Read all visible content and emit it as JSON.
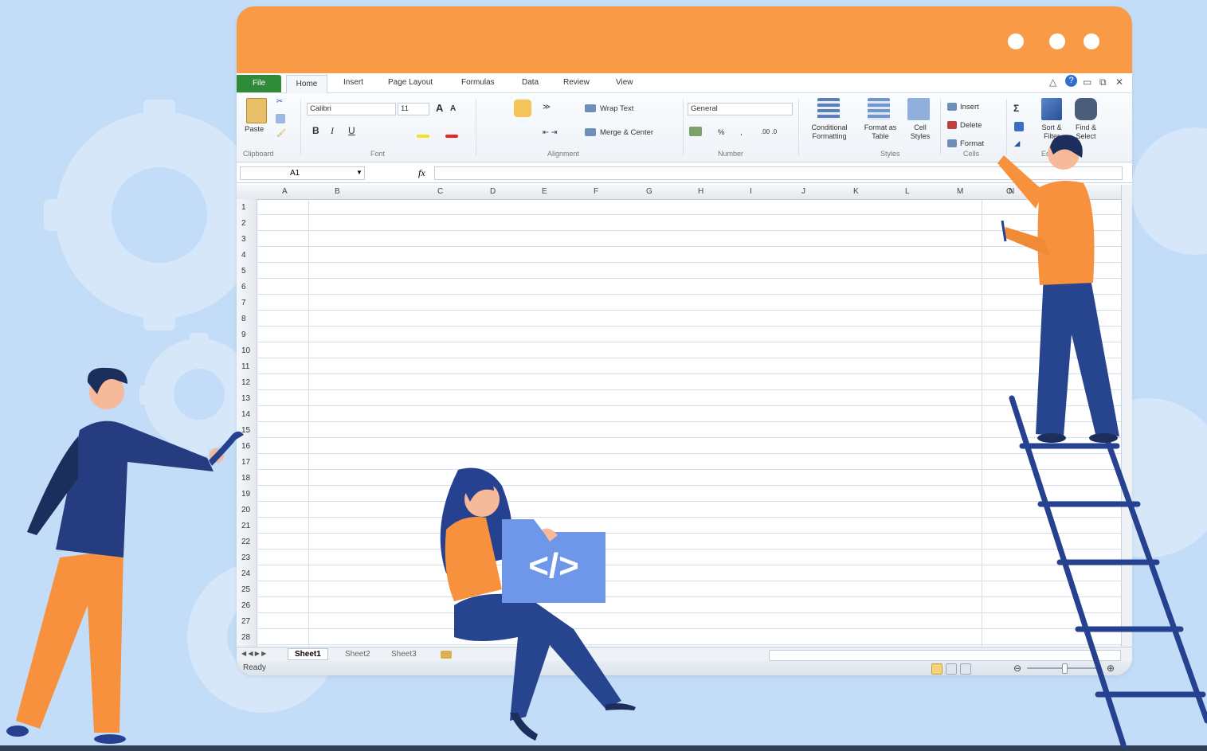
{
  "colors": {
    "background": "#c3ddf8",
    "titlebar": "#f99a47",
    "file_tab": "#2f8a3a",
    "code_card": "#6e97e9",
    "figure_orange": "#f7913d",
    "figure_navy": "#253d80"
  },
  "menu": {
    "file": "File",
    "tabs": [
      "Home",
      "Insert",
      "Page Layout",
      "Formulas",
      "Data",
      "Review",
      "View"
    ]
  },
  "ribbon": {
    "clipboard": {
      "paste": "Paste",
      "group": "Clipboard"
    },
    "font": {
      "name": "Calibri",
      "size": "11",
      "bold": "B",
      "italic": "I",
      "underline": "U",
      "grow": "A",
      "shrink": "A",
      "group": "Font"
    },
    "alignment": {
      "wrap_text": "Wrap Text",
      "merge_center": "Merge & Center",
      "group": "Alignment"
    },
    "number": {
      "format": "General",
      "percent": "%",
      "comma": ",",
      "group": "Number"
    },
    "styles": {
      "conditional": "Conditional Formatting",
      "format_table": "Format as Table",
      "cell_styles": "Cell Styles",
      "group": "Styles"
    },
    "cells": {
      "insert": "Insert",
      "delete": "Delete",
      "format": "Format",
      "group": "Cells"
    },
    "editing": {
      "sum": "Σ",
      "sort_filter": "Sort & Filter",
      "find_select": "Find & Select",
      "group": "Editing"
    }
  },
  "formula_bar": {
    "name_box": "A1",
    "fx": "fx"
  },
  "columns": [
    "A",
    "B",
    "C",
    "D",
    "E",
    "F",
    "G",
    "H",
    "I",
    "J",
    "K",
    "L",
    "M",
    "N",
    "O"
  ],
  "rows": [
    "1",
    "2",
    "3",
    "4",
    "5",
    "6",
    "7",
    "8",
    "9",
    "10",
    "11",
    "12",
    "13",
    "14",
    "15",
    "16",
    "17",
    "18",
    "19",
    "20",
    "21",
    "22",
    "23",
    "24",
    "25",
    "26",
    "27",
    "28"
  ],
  "sheets": [
    "Sheet1",
    "Sheet2",
    "Sheet3"
  ],
  "status": {
    "ready": "Ready"
  },
  "code_symbol": "</>"
}
